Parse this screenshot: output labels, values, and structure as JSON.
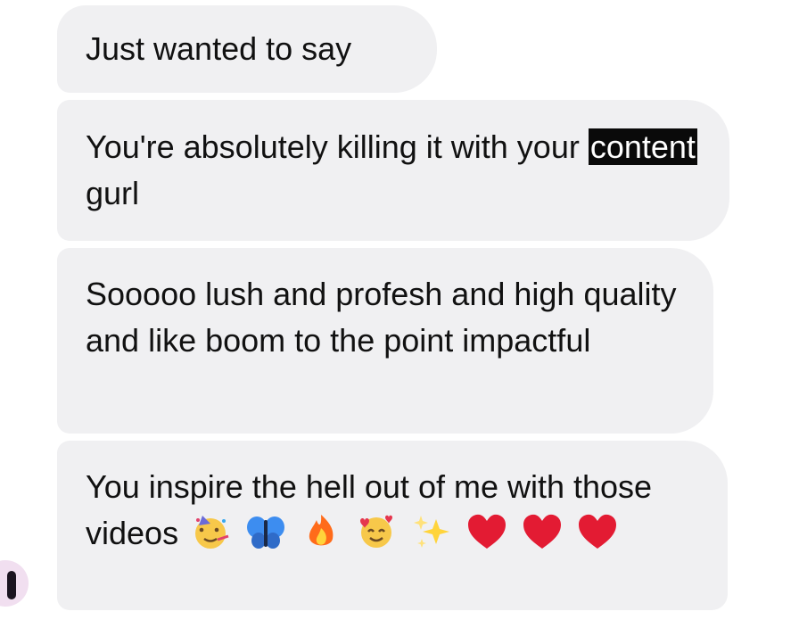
{
  "messages": [
    {
      "text": "Just wanted to say"
    },
    {
      "text_redacted": "content",
      "text_before": "You're absolutely killing it with your ",
      "text_after": " gurl"
    },
    {
      "text": "Sooooo lush and profesh and high quality and like boom to the point impactful"
    },
    {
      "text": "You inspire the hell out of me with those videos",
      "emojis": [
        "partying-face-icon",
        "butterfly-icon",
        "fire-icon",
        "smiling-face-with-hearts-icon",
        "sparkles-icon",
        "red-heart-icon",
        "red-heart-icon",
        "red-heart-icon"
      ]
    }
  ],
  "colors": {
    "bubble": "#f0f0f2",
    "text": "#111111",
    "redaction": "#0a0a0a",
    "avatar": "#f1dff0"
  }
}
